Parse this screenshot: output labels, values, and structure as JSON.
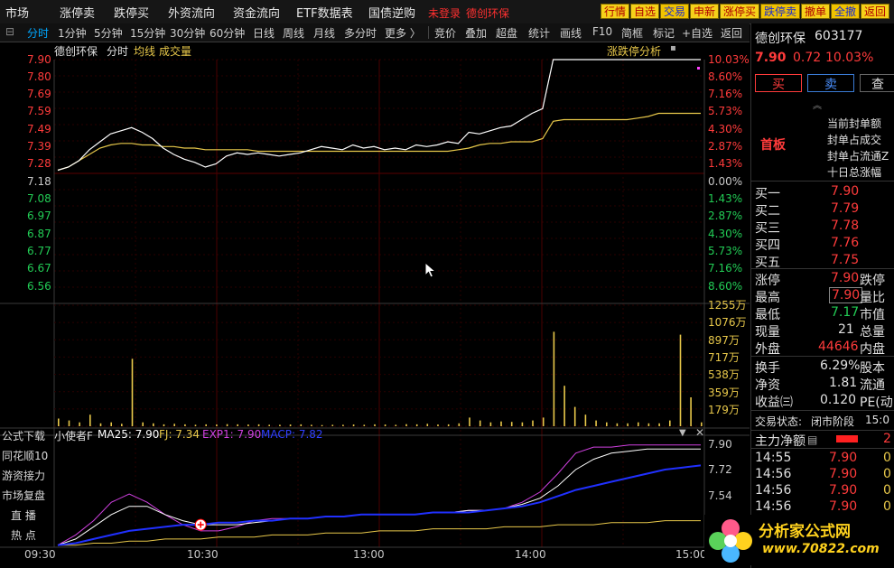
{
  "top_menu": {
    "items": [
      "市场",
      "涨停卖",
      "跌停买",
      "外资流向",
      "资金流向",
      "ETF数据表",
      "国债逆购"
    ],
    "login": "未登录",
    "stock_name_red": "德创环保",
    "quick_buttons": [
      "行情",
      "自选",
      "交易",
      "申新",
      "涨停买",
      "跌停卖",
      "撤单",
      "全撤",
      "返回"
    ]
  },
  "toolbar": {
    "left": [
      "分时",
      "1分钟",
      "5分钟",
      "15分钟",
      "30分钟",
      "60分钟",
      "日线",
      "周线",
      "月线",
      "多分时",
      "更多 〉"
    ],
    "right": [
      "竞价",
      "叠加",
      "超盘",
      "统计",
      "画线",
      "F10",
      "简框",
      "标记",
      "+自选",
      "返回"
    ]
  },
  "chart_header": {
    "name": "德创环保",
    "mode": "分时",
    "avg_label": "均线",
    "vol_label": "成交量",
    "analysis_link": "涨跌停分析"
  },
  "indicator_header": {
    "name": "小使者F",
    "ma25": "MA25: 7.90",
    "fj": "FJ: 7.34",
    "exp1": "EXP1: 7.90",
    "macp": "MACP: 7.82"
  },
  "side_buttons": [
    "公式下载",
    "同花顺10",
    "游资接力",
    "市场复盘",
    "直 播",
    "热 点"
  ],
  "chart_data": {
    "type": "line",
    "price_axis": [
      "7.90",
      "7.80",
      "7.69",
      "7.59",
      "7.49",
      "7.39",
      "7.28",
      "7.18",
      "7.08",
      "6.97",
      "6.87",
      "6.77",
      "6.67",
      "6.56"
    ],
    "pct_axis": [
      "10.03%",
      "8.60%",
      "7.16%",
      "5.73%",
      "4.30%",
      "2.87%",
      "1.43%",
      "0.00%",
      "1.43%",
      "2.87%",
      "4.30%",
      "5.73%",
      "7.16%",
      "8.60%"
    ],
    "volume_axis": [
      "1255万",
      "1076万",
      "897万",
      "717万",
      "538万",
      "359万",
      "179万"
    ],
    "indicator_axis": [
      "7.90",
      "7.72",
      "7.54"
    ],
    "x_ticks": [
      "09:30",
      "10:30",
      "13:00",
      "14:00",
      "15:00"
    ],
    "price": [
      7.2,
      7.22,
      7.26,
      7.33,
      7.38,
      7.43,
      7.45,
      7.47,
      7.44,
      7.4,
      7.34,
      7.3,
      7.27,
      7.25,
      7.22,
      7.24,
      7.29,
      7.31,
      7.3,
      7.31,
      7.3,
      7.29,
      7.3,
      7.31,
      7.33,
      7.35,
      7.34,
      7.33,
      7.36,
      7.34,
      7.35,
      7.33,
      7.34,
      7.33,
      7.36,
      7.35,
      7.36,
      7.38,
      7.37,
      7.44,
      7.43,
      7.45,
      7.47,
      7.48,
      7.52,
      7.56,
      7.59,
      7.9,
      7.9,
      7.9,
      7.9,
      7.9,
      7.9,
      7.9,
      7.9,
      7.9,
      7.9,
      7.9,
      7.9,
      7.9,
      7.9,
      7.9
    ],
    "avg": [
      7.2,
      7.22,
      7.26,
      7.3,
      7.34,
      7.36,
      7.37,
      7.37,
      7.36,
      7.36,
      7.35,
      7.35,
      7.34,
      7.34,
      7.33,
      7.33,
      7.33,
      7.33,
      7.33,
      7.32,
      7.32,
      7.32,
      7.32,
      7.32,
      7.32,
      7.32,
      7.32,
      7.32,
      7.32,
      7.32,
      7.32,
      7.32,
      7.32,
      7.32,
      7.32,
      7.32,
      7.32,
      7.32,
      7.33,
      7.34,
      7.36,
      7.37,
      7.37,
      7.38,
      7.38,
      7.38,
      7.4,
      7.51,
      7.52,
      7.52,
      7.52,
      7.52,
      7.52,
      7.52,
      7.52,
      7.53,
      7.54,
      7.56,
      7.56,
      7.56,
      7.56,
      7.56
    ],
    "volume": [
      80,
      60,
      40,
      120,
      30,
      40,
      25,
      700,
      40,
      30,
      20,
      25,
      20,
      15,
      20,
      18,
      22,
      20,
      18,
      20,
      15,
      15,
      18,
      20,
      15,
      12,
      15,
      15,
      18,
      15,
      20,
      18,
      15,
      22,
      20,
      25,
      18,
      20,
      30,
      90,
      60,
      40,
      50,
      45,
      40,
      60,
      90,
      980,
      420,
      200,
      120,
      60,
      40,
      30,
      30,
      40,
      30,
      30,
      60,
      950,
      300,
      40
    ],
    "indicator": {
      "exp1": [
        7.43,
        7.48,
        7.55,
        7.64,
        7.68,
        7.64,
        7.58,
        7.53,
        7.5,
        7.5,
        7.52,
        7.55,
        7.56,
        7.56,
        7.56,
        7.57,
        7.57,
        7.58,
        7.58,
        7.58,
        7.58,
        7.59,
        7.59,
        7.6,
        7.6,
        7.61,
        7.64,
        7.69,
        7.78,
        7.88,
        7.91,
        7.91,
        7.92,
        7.92,
        7.92,
        7.92,
        7.92
      ],
      "ma25": [
        7.43,
        7.46,
        7.52,
        7.58,
        7.62,
        7.62,
        7.58,
        7.55,
        7.53,
        7.53,
        7.53,
        7.54,
        7.55,
        7.56,
        7.56,
        7.57,
        7.57,
        7.58,
        7.58,
        7.58,
        7.58,
        7.59,
        7.59,
        7.6,
        7.6,
        7.61,
        7.63,
        7.66,
        7.72,
        7.8,
        7.85,
        7.88,
        7.89,
        7.9,
        7.9,
        7.9,
        7.9
      ],
      "macp": [
        7.43,
        7.44,
        7.46,
        7.48,
        7.5,
        7.51,
        7.52,
        7.53,
        7.53,
        7.54,
        7.54,
        7.55,
        7.55,
        7.56,
        7.56,
        7.57,
        7.57,
        7.58,
        7.58,
        7.58,
        7.58,
        7.59,
        7.59,
        7.59,
        7.6,
        7.61,
        7.62,
        7.64,
        7.67,
        7.7,
        7.72,
        7.74,
        7.76,
        7.78,
        7.8,
        7.81,
        7.82
      ],
      "fj": [
        7.43,
        7.43,
        7.44,
        7.44,
        7.45,
        7.45,
        7.46,
        7.46,
        7.46,
        7.47,
        7.47,
        7.47,
        7.48,
        7.48,
        7.48,
        7.49,
        7.49,
        7.49,
        7.5,
        7.5,
        7.5,
        7.51,
        7.51,
        7.51,
        7.51,
        7.52,
        7.52,
        7.52,
        7.53,
        7.53,
        7.53,
        7.54,
        7.54,
        7.54,
        7.55,
        7.55,
        7.55
      ]
    }
  },
  "right_panel": {
    "stock_name": "德创环保",
    "stock_code": "603177",
    "price": "7.90",
    "change": "0.72",
    "change_pct": "10.03%",
    "buy_btn": "买",
    "sell_btn": "卖",
    "more_btn": "查",
    "board_label": "首板",
    "board_info": [
      "当前封单额",
      "封单占成交",
      "封单占流通Z",
      "十日总涨幅"
    ],
    "bids": [
      {
        "label": "买一",
        "price": "7.90"
      },
      {
        "label": "买二",
        "price": "7.79"
      },
      {
        "label": "买三",
        "price": "7.78"
      },
      {
        "label": "买四",
        "price": "7.76"
      },
      {
        "label": "买五",
        "price": "7.75"
      }
    ],
    "stats": [
      {
        "l1": "涨停",
        "v1": "7.90",
        "l2": "跌停"
      },
      {
        "l1": "最高",
        "v1": "7.90",
        "l2": "量比"
      },
      {
        "l1": "最低",
        "v1": "7.17",
        "l2": "市值"
      },
      {
        "l1": "现量",
        "v1": "21",
        "l2": "总量"
      },
      {
        "l1": "外盘",
        "v1": "44646",
        "l2": "内盘"
      },
      {
        "l1": "换手",
        "v1": "6.29%",
        "l2": "股本"
      },
      {
        "l1": "净资",
        "v1": "1.81",
        "l2": "流通"
      },
      {
        "l1": "收益㈢",
        "v1": "0.120",
        "l2": "PE(动"
      }
    ],
    "trade_status_label": "交易状态:",
    "trade_status": "闭市阶段",
    "trade_status_time": "15:0",
    "main_flow_label": "主力净额",
    "main_flow_value": "2",
    "ticks": [
      {
        "time": "14:55",
        "price": "7.90",
        "vol": "0"
      },
      {
        "time": "14:56",
        "price": "7.90",
        "vol": "0"
      },
      {
        "time": "14:56",
        "price": "7.90",
        "vol": "0"
      },
      {
        "time": "14:56",
        "price": "7.90",
        "vol": "0"
      }
    ]
  },
  "logo": {
    "brand": "分析家公式网",
    "url": "www.70822.com"
  },
  "colors": {
    "up": "#ff3b3b",
    "down": "#22cc55",
    "price_line": "#ffffff",
    "avg_line": "#e8c84a",
    "volume": "#e8c84a",
    "grid": "#3a0000",
    "exp1": "#d040e0",
    "macp": "#2030ff",
    "accent": "#00a8ff"
  }
}
